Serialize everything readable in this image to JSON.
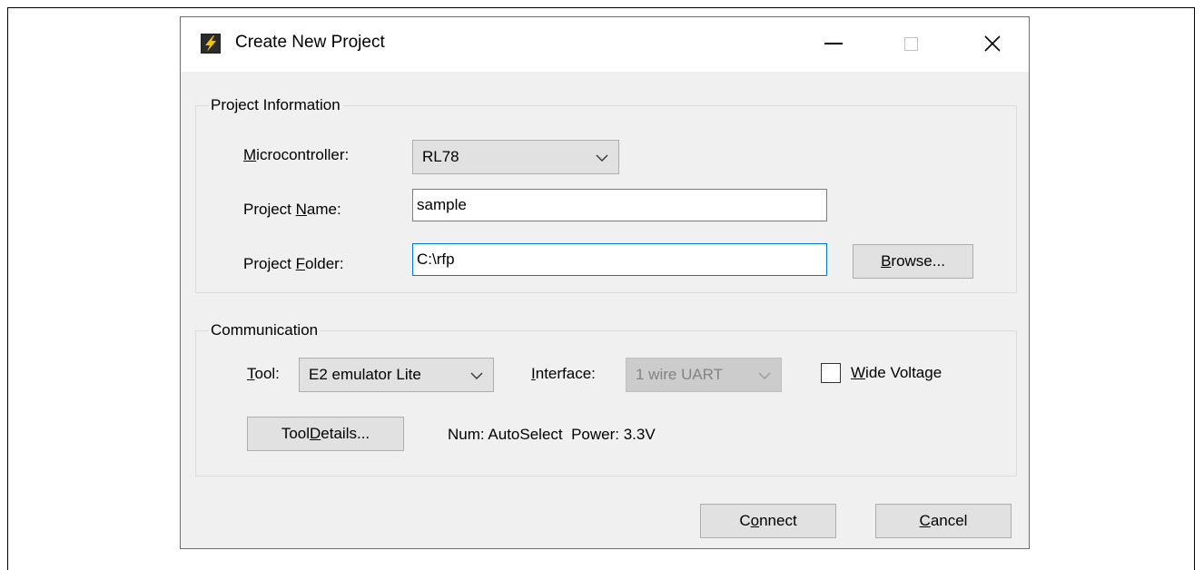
{
  "window": {
    "title": "Create New Project"
  },
  "project_info": {
    "group_label": "Project Information",
    "microcontroller": {
      "label_mnemonic": "M",
      "label_rest": "icrocontroller:",
      "value": "RL78"
    },
    "project_name": {
      "label_pre": "Project ",
      "label_mnemonic": "N",
      "label_rest": "ame:",
      "value": "sample"
    },
    "project_folder": {
      "label_pre": "Project ",
      "label_mnemonic": "F",
      "label_rest": "older:",
      "value": "C:\\rfp"
    },
    "browse_button": {
      "mnemonic": "B",
      "rest": "rowse..."
    }
  },
  "communication": {
    "group_label": "Communication",
    "tool": {
      "label_mnemonic": "T",
      "label_rest": "ool:",
      "value": "E2 emulator Lite"
    },
    "interface": {
      "label_mnemonic": "I",
      "label_rest": "nterface:",
      "value": "1 wire UART"
    },
    "wide_voltage": {
      "label_mnemonic": "W",
      "label_rest": "ide Voltage"
    },
    "tool_details_button": {
      "pre": "Tool ",
      "mnemonic": "D",
      "rest": "etails..."
    },
    "status_text": "Num: AutoSelect  Power: 3.3V"
  },
  "footer": {
    "connect_button": {
      "pre": "C",
      "mnemonic": "o",
      "rest": "nnect"
    },
    "cancel_button": {
      "mnemonic": "C",
      "rest": "ancel"
    }
  },
  "colors": {
    "dialog_bg": "#f0f0f0",
    "focus_border": "#0078d7",
    "disabled_text": "#838383"
  }
}
